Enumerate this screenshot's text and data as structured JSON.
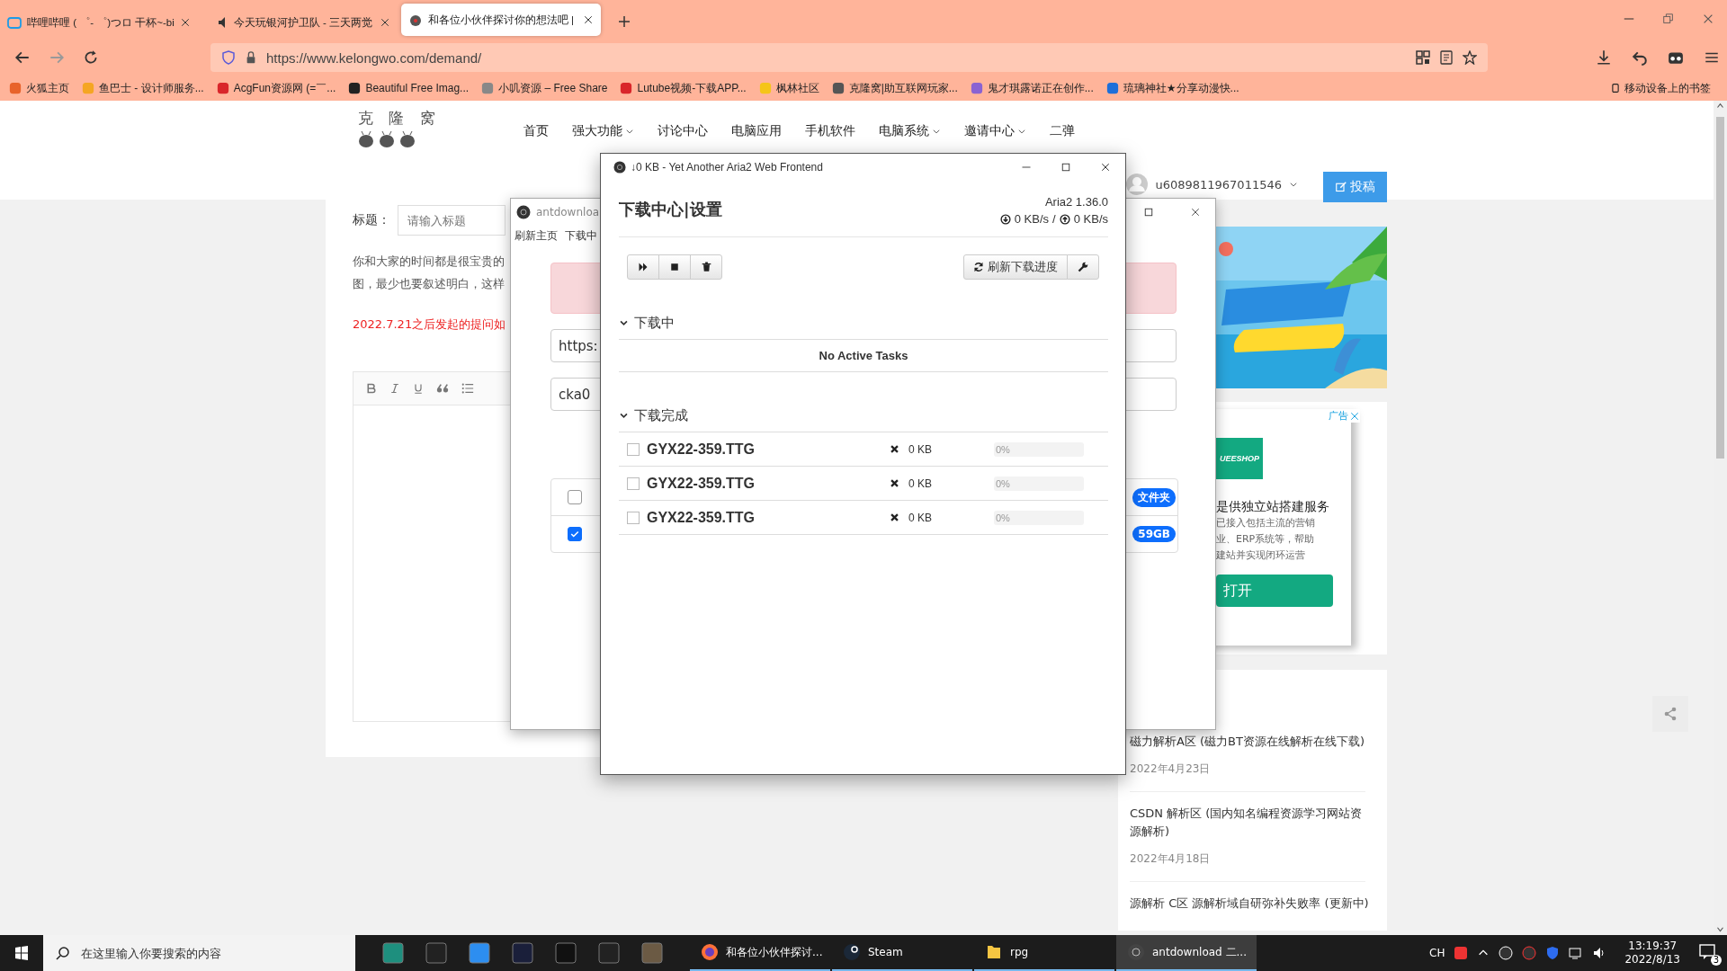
{
  "browser": {
    "tabs": [
      {
        "title": "哔哩哔哩 ( ゜- ゜)つロ 干杯~-bi",
        "selected": false
      },
      {
        "title": "今天玩银河护卫队 - 三天两觉",
        "selected": false
      },
      {
        "title": "和各位小伙伴探讨你的想法吧 |",
        "selected": true
      }
    ],
    "url": "https://www.kelongwo.com/demand/",
    "bookmarks": [
      "火狐主页",
      "鱼巴士 - 设计师服务...",
      "AcgFun资源网 (=￣...",
      "Beautiful Free Imag...",
      "小叽资源 – Free Share",
      "Lutube视频-下载APP...",
      "枫林社区",
      "克隆窝|助互联网玩家...",
      "鬼才琪露诺正在创作...",
      "琉璃神社★分享动漫快..."
    ],
    "mobile_bookmarks": "移动设备上的书签"
  },
  "site": {
    "logo": "克 隆 窝",
    "nav": [
      {
        "label": "首页",
        "dropdown": false
      },
      {
        "label": "强大功能",
        "dropdown": true
      },
      {
        "label": "讨论中心",
        "dropdown": false
      },
      {
        "label": "电脑应用",
        "dropdown": false
      },
      {
        "label": "手机软件",
        "dropdown": false
      },
      {
        "label": "电脑系统",
        "dropdown": true
      },
      {
        "label": "邀请中心",
        "dropdown": true
      },
      {
        "label": "二弹",
        "dropdown": false
      }
    ],
    "user": "u6089811967011546",
    "post_button": "投稿"
  },
  "form": {
    "title_label": "标题：",
    "title_placeholder": "请输入标题",
    "notes": [
      "你和大家的时间都是很宝贵的",
      "图，最少也要叙述明白，这样"
    ],
    "warning": "2022.7.21之后发起的提问如"
  },
  "antdownload": {
    "title": "antdownloa",
    "menu": [
      "刷新主页",
      "下载中"
    ],
    "fields": [
      {
        "value": "https:"
      },
      {
        "value": "cka0"
      }
    ],
    "rows": [
      {
        "checked": false,
        "badge": "文件夹"
      },
      {
        "checked": true,
        "badge": "59GB"
      }
    ]
  },
  "aria": {
    "title": "↓0 KB - Yet Another Aria2 Web Frontend",
    "heading": "下载中心|设置",
    "version": "Aria2 1.36.0",
    "download_speed": "0 KB/s",
    "separator": "/",
    "upload_speed": "0 KB/s",
    "refresh_button": "刷新下载进度",
    "sections": [
      {
        "title": "下载中",
        "expanded": true,
        "message": "No Active Tasks"
      },
      {
        "title": "下载完成",
        "expanded": true,
        "tasks": [
          {
            "name": "GYX22-359.TTG",
            "checked": false,
            "size": "0 KB",
            "level": 0,
            "progress": "0%"
          },
          {
            "name": "GYX22-359.TTG",
            "checked": false,
            "size": "0 KB",
            "level": 0,
            "progress": "0%"
          },
          {
            "name": "GYX22-359.TTG",
            "checked": false,
            "size": "0 KB",
            "level": 0,
            "progress": "0%"
          }
        ]
      }
    ]
  },
  "sidebar": {
    "ad": {
      "tag": "广告",
      "logo": "UEESHOP",
      "headline": "是供独立站搭建服务",
      "lines": [
        "已接入包括主流的营销",
        "业、ERP系统等，帮助",
        "建站并实现闭环运营"
      ],
      "button": "打开"
    },
    "posts": [
      {
        "title": "磁力解析A区 (磁力BT资源在线解析在线下载)",
        "date": "2022年4月23日"
      },
      {
        "title": "CSDN 解析区 (国内知名编程资源学习网站资源解析)",
        "date": "2022年4月18日"
      },
      {
        "title": "源解析 C区 源解析域自研弥补失败率 (更新中)"
      }
    ]
  },
  "taskbar": {
    "search_placeholder": "在这里输入你要搜索的内容",
    "apps": [
      {
        "label": "和各位小伙伴探讨...",
        "selected": false
      },
      {
        "label": "Steam",
        "selected": false
      },
      {
        "label": "rpg",
        "selected": false
      },
      {
        "label": "antdownload 二...",
        "selected": true
      }
    ],
    "input_method": "CH",
    "time": "13:19:37",
    "date": "2022/8/13",
    "notifications": "3"
  }
}
